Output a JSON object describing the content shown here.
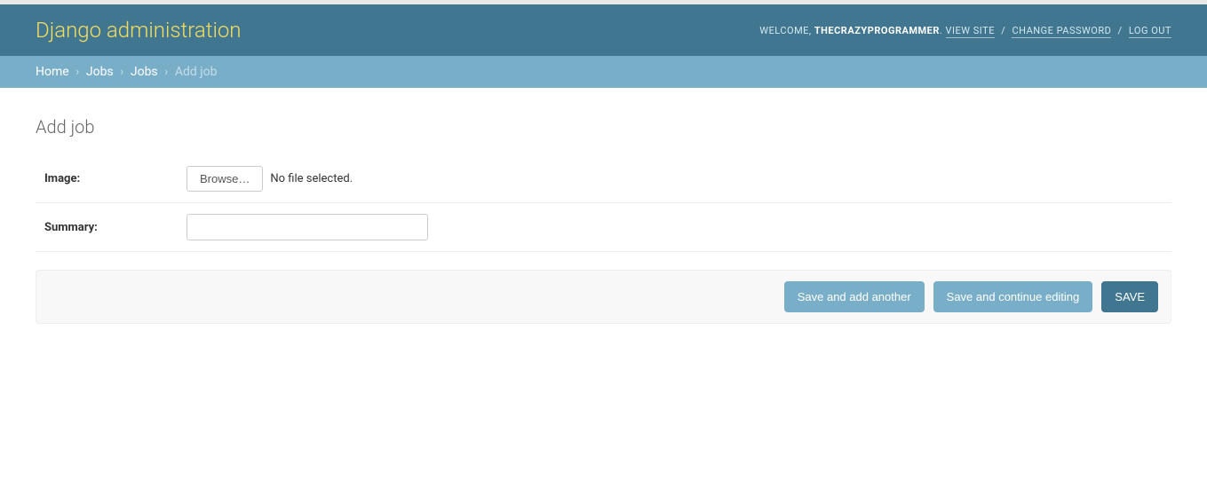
{
  "header": {
    "site_title": "Django administration",
    "welcome": "WELCOME,",
    "username": "THECRAZYPROGRAMMER",
    "dot": ".",
    "view_site": "VIEW SITE",
    "change_password": "CHANGE PASSWORD",
    "log_out": "LOG OUT",
    "sep": "/"
  },
  "breadcrumbs": {
    "home": "Home",
    "app": "Jobs",
    "model": "Jobs",
    "current": "Add job",
    "sep": "›"
  },
  "page": {
    "title": "Add job"
  },
  "form": {
    "image": {
      "label": "Image:",
      "browse": "Browse…",
      "no_file": "No file selected."
    },
    "summary": {
      "label": "Summary:",
      "value": ""
    }
  },
  "buttons": {
    "save_add_another": "Save and add another",
    "save_continue": "Save and continue editing",
    "save": "SAVE"
  }
}
